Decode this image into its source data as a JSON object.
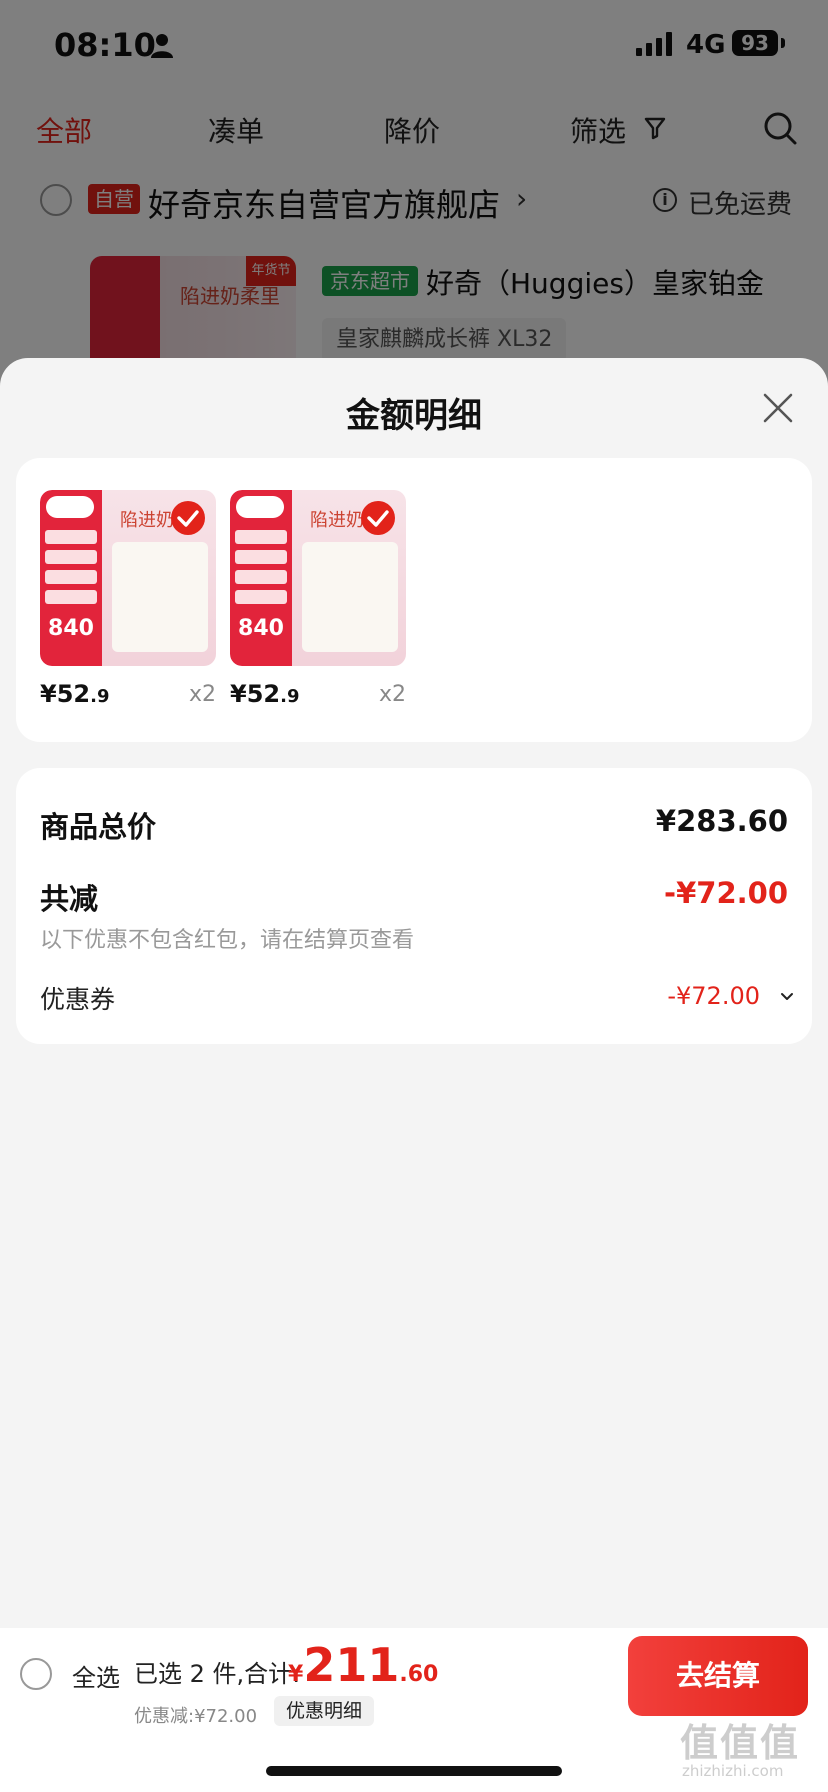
{
  "status_bar": {
    "time": "08:10",
    "network": "4G",
    "battery": "93"
  },
  "tabs": [
    {
      "label": "全部",
      "active": true
    },
    {
      "label": "凑单",
      "active": false
    },
    {
      "label": "降价",
      "active": false
    },
    {
      "label": "筛选",
      "active": false
    }
  ],
  "store": {
    "badge": "自营",
    "name": "好奇京东自营官方旗舰店",
    "shipping": "已免运费"
  },
  "background_product": {
    "thumb_label": "陷进奶柔里",
    "thumb_tag": "年货节",
    "market_badge": "京东超市",
    "title": "好奇（Huggies）皇家铂金",
    "variant": "皇家麒麟成长裤 XL32"
  },
  "sheet": {
    "title": "金额明细",
    "items": [
      {
        "price_int": "¥52",
        "price_dec": ".9",
        "qty": "x2",
        "thumb_price": "840",
        "thumb_text": "陷进奶"
      },
      {
        "price_int": "¥52",
        "price_dec": ".9",
        "qty": "x2",
        "thumb_price": "840",
        "thumb_text": "陷进奶"
      }
    ],
    "summary": {
      "total_label": "商品总价",
      "total_value": "¥283.60",
      "discount_label": "共减",
      "discount_value": "-¥72.00",
      "note": "以下优惠不包含红包，请在结算页查看",
      "coupon_label": "优惠券",
      "coupon_value": "-¥72.00"
    }
  },
  "bottom_bar": {
    "select_all": "全选",
    "selected_info": "已选 2 件,合计:",
    "currency": "¥",
    "total_int": "211",
    "total_dec": ".60",
    "discount_line": "优惠减:¥72.00",
    "detail_chip": "优惠明细",
    "checkout": "去结算"
  },
  "watermark": {
    "big": "值值值",
    "small": "zhizhizhi.com"
  },
  "colors": {
    "accent": "#e2231a",
    "market_green": "#1aa34a"
  }
}
